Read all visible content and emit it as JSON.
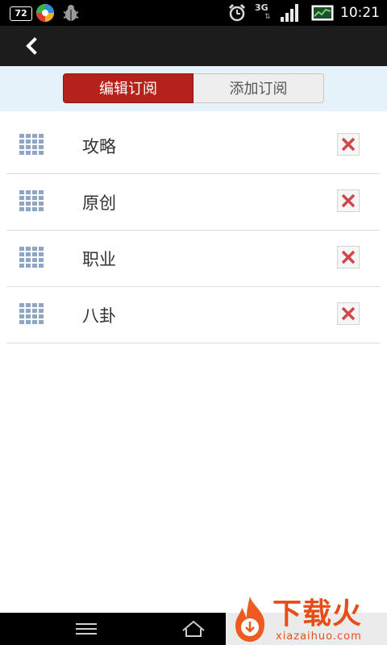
{
  "status_bar": {
    "badge": "72",
    "network": "3G",
    "network_arrows": "⇅",
    "time": "10:21",
    "icons": [
      "notification-badge-icon",
      "app-logo-icon",
      "bug-icon",
      "alarm-clock-icon",
      "signal-icon",
      "battery-icon"
    ]
  },
  "title_bar": {
    "back_icon": "chevron-left-icon"
  },
  "tabs": [
    {
      "label": "编辑订阅",
      "active": true
    },
    {
      "label": "添加订阅",
      "active": false
    }
  ],
  "subscriptions": [
    {
      "label": "攻略"
    },
    {
      "label": "原创"
    },
    {
      "label": "职业"
    },
    {
      "label": "八卦"
    }
  ],
  "nav_bar": {
    "icons": [
      "menu-icon",
      "home-icon"
    ]
  },
  "watermark": {
    "title": "下载火",
    "url": "xiazaihuo.com"
  },
  "colors": {
    "accent": "#b5211b",
    "segment_bar_bg": "#e6f2fa",
    "delete_x": "#d0464a",
    "drag_handle": "#8ea5c6",
    "watermark": "#e84d17"
  }
}
